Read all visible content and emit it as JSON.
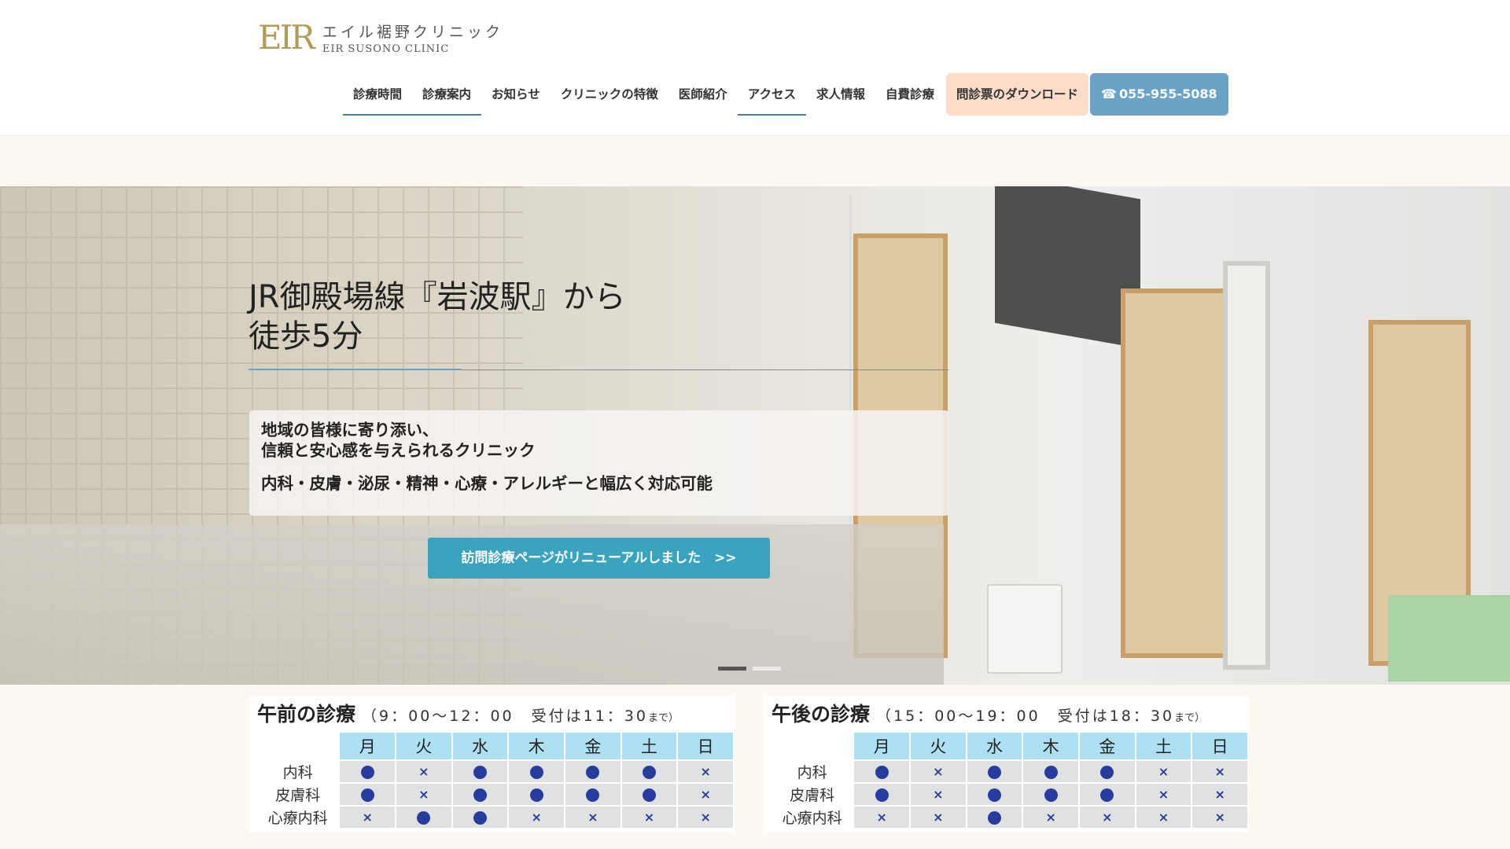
{
  "brand": {
    "mark": "EIR",
    "name_jp": "エイル裾野クリニック",
    "name_en": "EIR SUSONO CLINIC",
    "accent_color": "#b29a58"
  },
  "nav": {
    "items": [
      {
        "label": "診療時間",
        "underlined": true
      },
      {
        "label": "診療案内",
        "underlined": true
      },
      {
        "label": "お知らせ",
        "underlined": false
      },
      {
        "label": "クリニックの特徴",
        "underlined": false
      },
      {
        "label": "医師紹介",
        "underlined": false
      },
      {
        "label": "アクセス",
        "underlined": true
      },
      {
        "label": "求人情報",
        "underlined": false
      },
      {
        "label": "自費診療",
        "underlined": false
      }
    ],
    "download_label": "問診票のダウンロード",
    "phone_icon": "phone-icon",
    "phone_label": "055-955-5088",
    "download_color": "#fbdcc8",
    "phone_color": "#6aa2c8"
  },
  "hero": {
    "title_line1": "JR御殿場線『岩波駅』から",
    "title_line2": "徒歩5分",
    "desc_line1": "地域の皆様に寄り添い、",
    "desc_line2": "信頼と安心感を与えられるクリニック",
    "desc_line3": "内科・皮膚・泌尿・精神・心療・アレルギーと幅広く対応可能",
    "button_label": "訪問診療ページがリニューアルしました　>>",
    "button_color": "#3aa3bd",
    "slides": [
      {
        "active": true
      },
      {
        "active": false
      }
    ]
  },
  "schedule": {
    "days": [
      "月",
      "火",
      "水",
      "木",
      "金",
      "土",
      "日"
    ],
    "legend": {
      "open": "●",
      "closed": "×"
    },
    "am": {
      "title": "午前の診療",
      "time": "（9：00〜12：00　受付は11：30",
      "note": "まで）",
      "rows": [
        {
          "label": "内科",
          "marks": [
            "●",
            "×",
            "●",
            "●",
            "●",
            "●",
            "×"
          ]
        },
        {
          "label": "皮膚科",
          "marks": [
            "●",
            "×",
            "●",
            "●",
            "●",
            "●",
            "×"
          ]
        },
        {
          "label": "心療内科",
          "marks": [
            "×",
            "●",
            "●",
            "×",
            "×",
            "×",
            "×"
          ]
        }
      ]
    },
    "pm": {
      "title": "午後の診療",
      "time": "（15：00〜19：00　受付は18：30",
      "note": "まで）",
      "rows": [
        {
          "label": "内科",
          "marks": [
            "●",
            "×",
            "●",
            "●",
            "●",
            "×",
            "×"
          ]
        },
        {
          "label": "皮膚科",
          "marks": [
            "●",
            "×",
            "●",
            "●",
            "●",
            "×",
            "×"
          ]
        },
        {
          "label": "心療内科",
          "marks": [
            "×",
            "×",
            "●",
            "×",
            "×",
            "×",
            "×"
          ]
        }
      ]
    },
    "header_color": "#aee0f4",
    "mark_color": "#283c9f"
  }
}
